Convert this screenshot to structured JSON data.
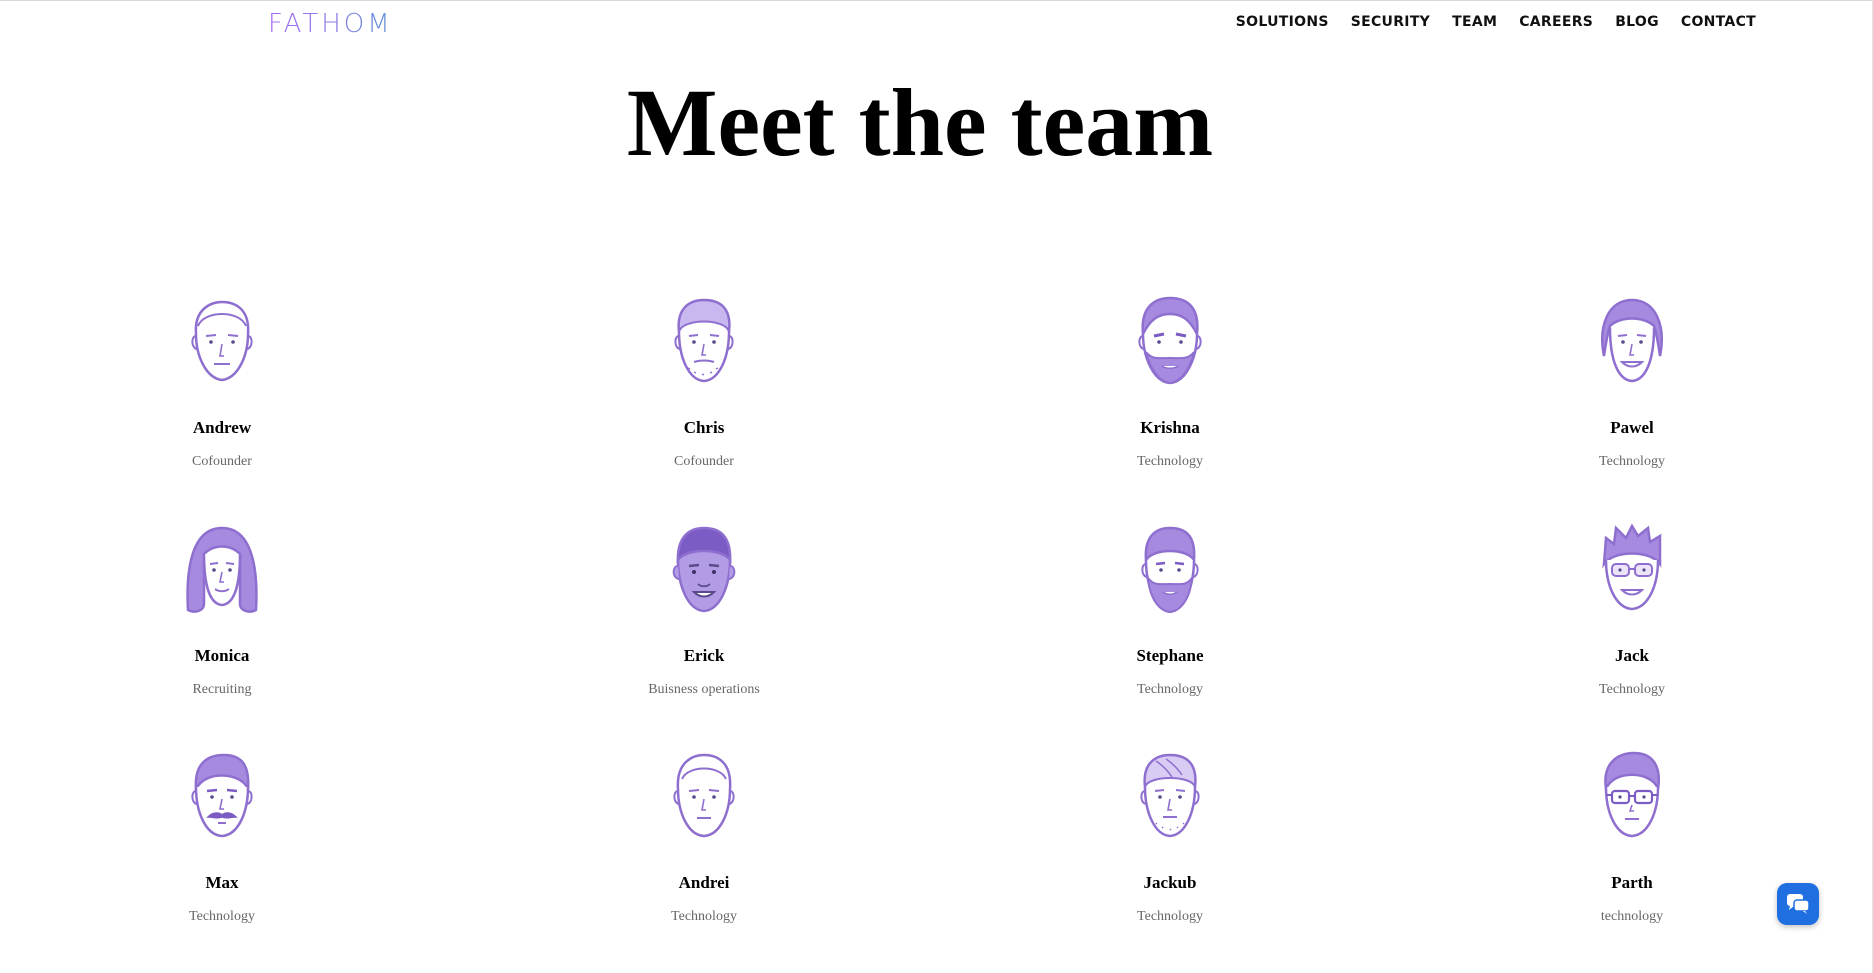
{
  "header": {
    "logo": "FATHOM",
    "nav": [
      "SOLUTIONS",
      "SECURITY",
      "TEAM",
      "CAREERS",
      "BLOG",
      "CONTACT"
    ]
  },
  "page": {
    "title": "Meet the team"
  },
  "team": [
    {
      "name": "Andrew",
      "role": "Cofounder",
      "avatar": "avatar-plain-male-icon"
    },
    {
      "name": "Chris",
      "role": "Cofounder",
      "avatar": "avatar-stubble-male-icon"
    },
    {
      "name": "Krishna",
      "role": "Technology",
      "avatar": "avatar-bearded-male-icon"
    },
    {
      "name": "Pawel",
      "role": "Technology",
      "avatar": "avatar-long-hair-male-icon"
    },
    {
      "name": "Monica",
      "role": "Recruiting",
      "avatar": "avatar-long-hair-female-icon"
    },
    {
      "name": "Erick",
      "role": "Buisness operations",
      "avatar": "avatar-filled-face-male-icon"
    },
    {
      "name": "Stephane",
      "role": "Technology",
      "avatar": "avatar-full-beard-male-icon"
    },
    {
      "name": "Jack",
      "role": "Technology",
      "avatar": "avatar-glasses-spiky-hair-icon"
    },
    {
      "name": "Max",
      "role": "Technology",
      "avatar": "avatar-mustache-male-icon"
    },
    {
      "name": "Andrei",
      "role": "Technology",
      "avatar": "avatar-plain-male-icon"
    },
    {
      "name": "Jackub",
      "role": "Technology",
      "avatar": "avatar-stubble-male-icon"
    },
    {
      "name": "Parth",
      "role": "technology",
      "avatar": "avatar-glasses-male-icon"
    }
  ],
  "colors": {
    "avatar_stroke": "#8e6fcf",
    "avatar_fill": "#b39ce6",
    "chat_button": "#1f6fe0"
  },
  "chat_widget": {
    "icon": "chat-bubbles-icon"
  }
}
